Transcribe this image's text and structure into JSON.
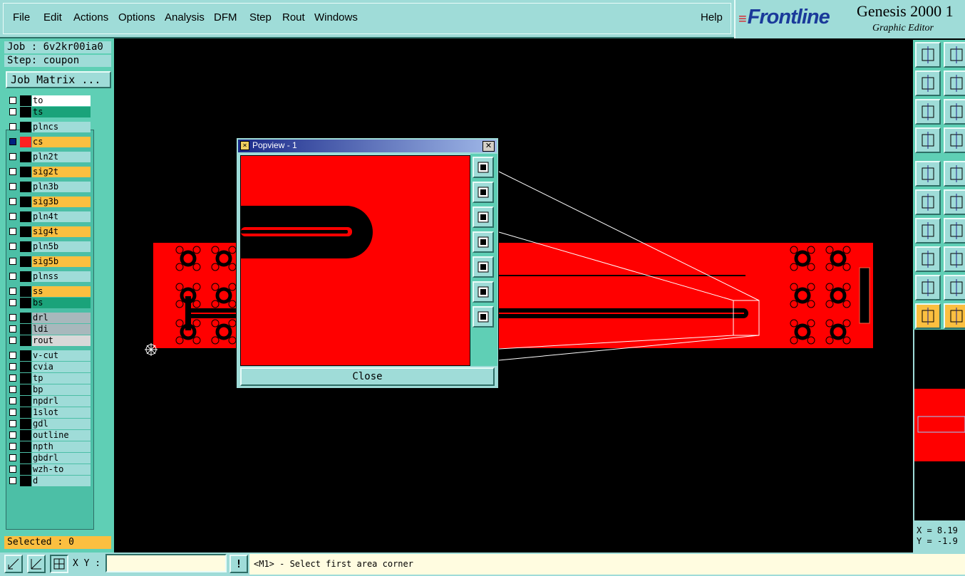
{
  "menubar": {
    "items": [
      "File",
      "Edit",
      "Actions",
      "Options",
      "Analysis",
      "DFM",
      "Step",
      "Rout",
      "Windows"
    ],
    "help": "Help"
  },
  "brand": {
    "logo": "Frontline",
    "product": "Genesis 2000 1",
    "subtitle": "Graphic Editor"
  },
  "job": {
    "job_line": "Job : 6v2kr00ia0",
    "step_line": "Step: coupon",
    "matrix_button": "Job Matrix ..."
  },
  "layers": [
    {
      "name": "to",
      "color": "#ffffff",
      "active": false
    },
    {
      "name": "ts",
      "color": "#1aa37a",
      "active": false
    },
    {
      "name": "plncs",
      "color": "#9fdcd8",
      "active": false
    },
    {
      "name": "cs",
      "color": "#fbbf40",
      "active": true
    },
    {
      "name": "pln2t",
      "color": "#9fdcd8",
      "active": false
    },
    {
      "name": "sig2t",
      "color": "#fbbf40",
      "active": false
    },
    {
      "name": "pln3b",
      "color": "#9fdcd8",
      "active": false
    },
    {
      "name": "sig3b",
      "color": "#fbbf40",
      "active": false
    },
    {
      "name": "pln4t",
      "color": "#9fdcd8",
      "active": false
    },
    {
      "name": "sig4t",
      "color": "#fbbf40",
      "active": false
    },
    {
      "name": "pln5b",
      "color": "#9fdcd8",
      "active": false
    },
    {
      "name": "sig5b",
      "color": "#fbbf40",
      "active": false
    },
    {
      "name": "plnss",
      "color": "#9fdcd8",
      "active": false
    },
    {
      "name": "ss",
      "color": "#fbbf40",
      "active": false
    },
    {
      "name": "bs",
      "color": "#1aa37a",
      "active": false
    },
    {
      "name": "drl",
      "color": "#a8b8bc",
      "active": false
    },
    {
      "name": "ldi",
      "color": "#a8b8bc",
      "active": false
    },
    {
      "name": "rout",
      "color": "#d8d8d8",
      "active": false
    },
    {
      "name": "v-cut",
      "color": "#9fdcd8",
      "active": false
    },
    {
      "name": "cvia",
      "color": "#9fdcd8",
      "active": false
    },
    {
      "name": "tp",
      "color": "#9fdcd8",
      "active": false
    },
    {
      "name": "bp",
      "color": "#9fdcd8",
      "active": false
    },
    {
      "name": "npdrl",
      "color": "#9fdcd8",
      "active": false
    },
    {
      "name": "1slot",
      "color": "#9fdcd8",
      "active": false
    },
    {
      "name": "gdl",
      "color": "#9fdcd8",
      "active": false
    },
    {
      "name": "outline",
      "color": "#9fdcd8",
      "active": false
    },
    {
      "name": "npth",
      "color": "#9fdcd8",
      "active": false
    },
    {
      "name": "gbdrl",
      "color": "#9fdcd8",
      "active": false
    },
    {
      "name": "wzh-to",
      "color": "#9fdcd8",
      "active": false
    },
    {
      "name": "d",
      "color": "#9fdcd8",
      "active": false
    }
  ],
  "selected": "Selected : 0",
  "bottom": {
    "xy_label": "X Y :",
    "xy_value": "",
    "warn": "!",
    "status": "<M1> - Select first area corner"
  },
  "coords": {
    "x": "X = 8.19",
    "y": "Y = -1.9"
  },
  "popview": {
    "title": "Popview - 1",
    "close_x": "✕",
    "close_button": "Close"
  },
  "colors": {
    "board": "#ff0000",
    "panel": "#5fcfb5",
    "button": "#9fdcd8",
    "accent": "#fbbf40"
  }
}
